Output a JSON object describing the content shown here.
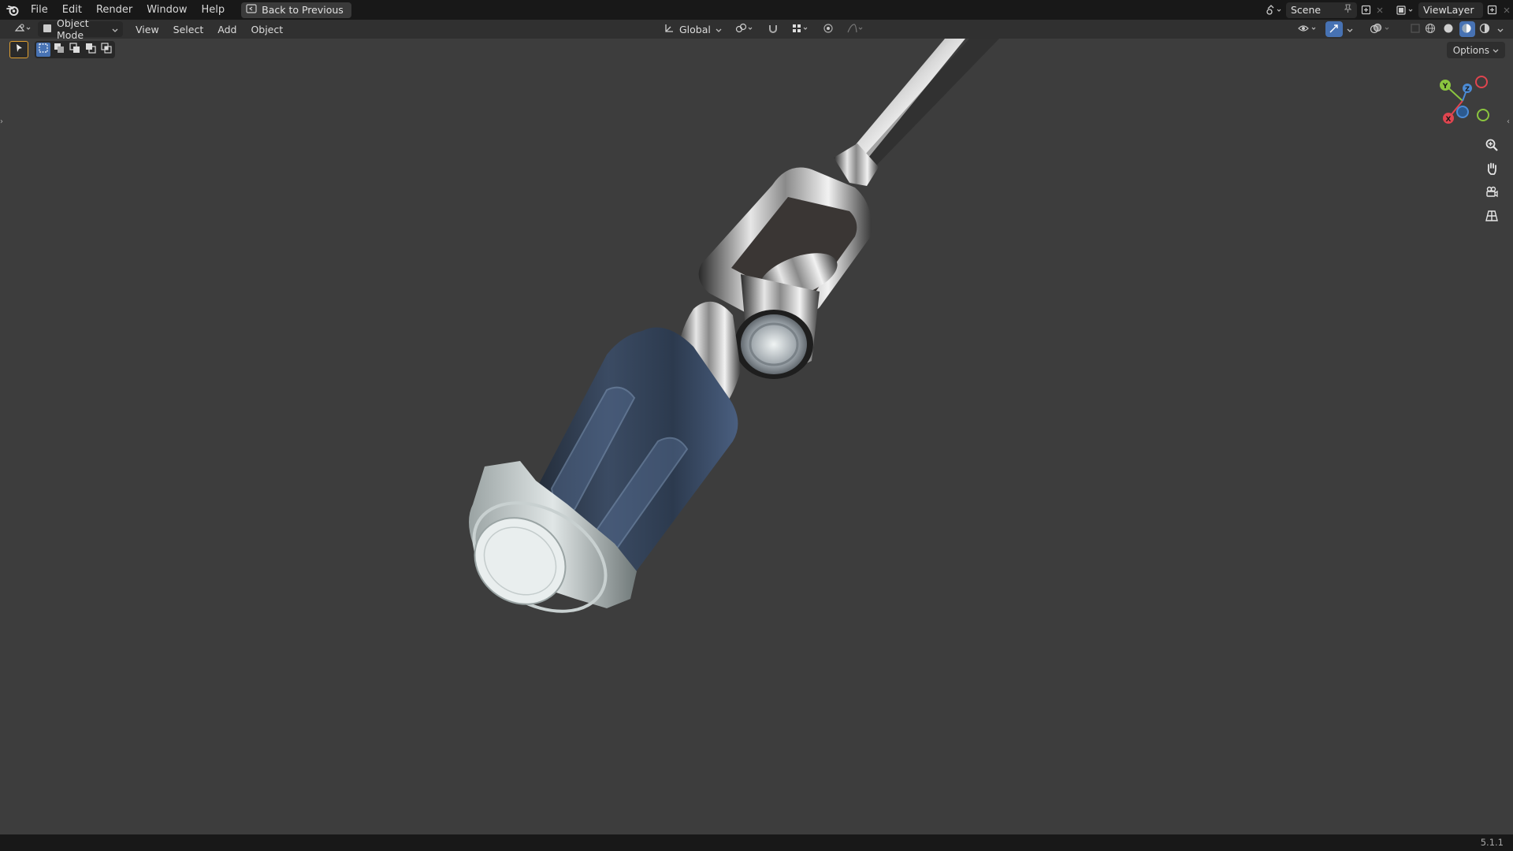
{
  "topbar": {
    "menus": [
      "File",
      "Edit",
      "Render",
      "Window",
      "Help"
    ],
    "back_button": "Back to Previous",
    "scene_name": "Scene",
    "view_layer_name": "ViewLayer"
  },
  "header": {
    "mode": "Object Mode",
    "menus": [
      "View",
      "Select",
      "Add",
      "Object"
    ],
    "transform_orientation": "Global"
  },
  "viewport": {
    "options_label": "Options",
    "gizmo": {
      "x_label": "X",
      "y_label": "Y",
      "z_label": "Z"
    },
    "colors": {
      "x_axis": "#e0454f",
      "y_axis": "#8bc53f",
      "z_axis": "#4b8bd6"
    }
  },
  "statusbar": {
    "version": "5.1.1"
  },
  "colors": {
    "accent": "#4772b3",
    "background": "#3d3d3d",
    "topbar": "#181818"
  }
}
